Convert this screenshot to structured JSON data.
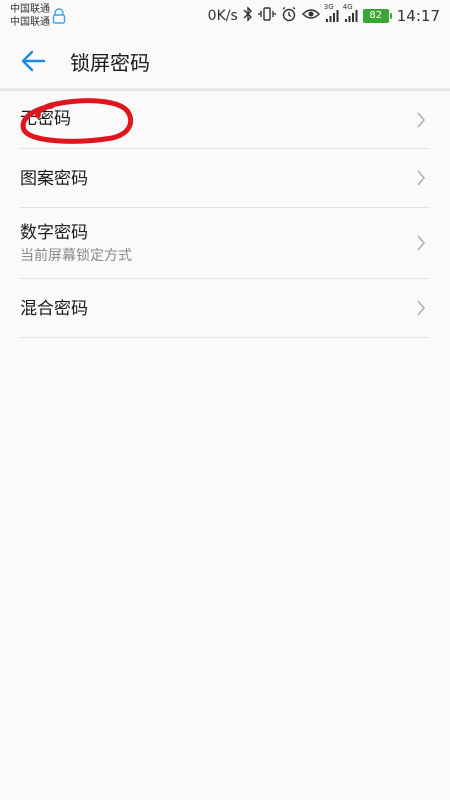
{
  "status_bar": {
    "carrier1": "中国联通",
    "carrier2": "中国联通",
    "speed": "0K/s",
    "signal1_label": "3G",
    "signal2_label": "4G",
    "battery": "82",
    "time": "14:17"
  },
  "header": {
    "title": "锁屏密码"
  },
  "list": {
    "items": [
      {
        "label": "无密码",
        "sub": ""
      },
      {
        "label": "图案密码",
        "sub": ""
      },
      {
        "label": "数字密码",
        "sub": "当前屏幕锁定方式"
      },
      {
        "label": "混合密码",
        "sub": ""
      }
    ]
  },
  "colors": {
    "accent": "#1e88e5",
    "annotation": "#e0161d",
    "battery": "#3aa635"
  },
  "icons": {
    "back": "arrow-left-icon",
    "chevron": "chevron-right-icon"
  }
}
